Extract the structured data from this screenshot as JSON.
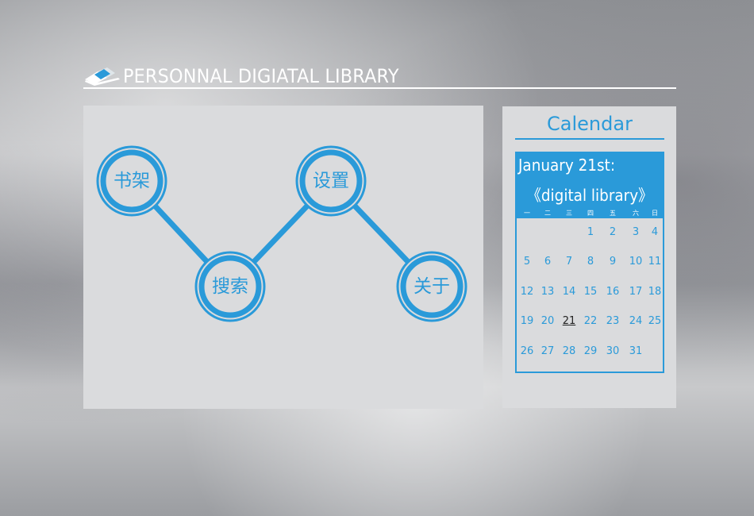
{
  "header": {
    "title": "PERSONNAL DIGIATAL LIBRARY",
    "logo_icon": "open-book-icon"
  },
  "nav": {
    "items": [
      {
        "label": "书架"
      },
      {
        "label": "搜索"
      },
      {
        "label": "设置"
      },
      {
        "label": "关于"
      }
    ]
  },
  "calendar": {
    "title": "Calendar",
    "date_label": "January 21st:",
    "subtitle": "《digital library》",
    "weekdays": [
      "一",
      "二",
      "三",
      "四",
      "五",
      "六",
      "日"
    ],
    "today": "21",
    "weeks": [
      [
        "",
        "",
        "",
        "1",
        "2",
        "3",
        "4"
      ],
      [
        "5",
        "6",
        "7",
        "8",
        "9",
        "10",
        "11"
      ],
      [
        "12",
        "13",
        "14",
        "15",
        "16",
        "17",
        "18"
      ],
      [
        "19",
        "20",
        "21",
        "22",
        "23",
        "24",
        "25"
      ],
      [
        "26",
        "27",
        "28",
        "29",
        "30",
        "31",
        ""
      ]
    ]
  },
  "colors": {
    "accent": "#2a9ad9",
    "panel": "#dadbdd"
  }
}
